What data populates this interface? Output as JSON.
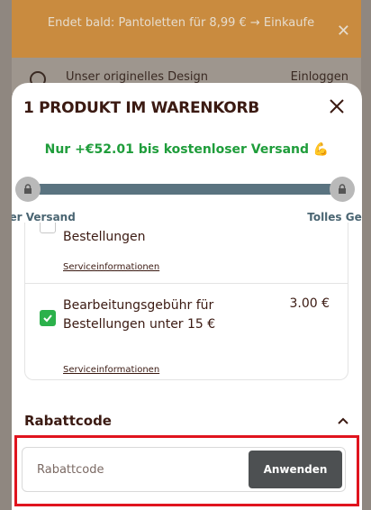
{
  "background": {
    "promo_text": "Endet bald: Pantoletten für 8,99 € → Einkaufe",
    "nav_brand": "Unser originelles Design",
    "nav_login": "Einloggen"
  },
  "cart": {
    "title": "1 PRODUKT IM WARENKORB",
    "shipping_message": "Nur +€52.01 bis kostenloser Versand 💪",
    "progress": {
      "fraction": 0,
      "left_label": "loser Versand",
      "right_label": "Tolles Gesc"
    },
    "items": [
      {
        "title": "Bestellungen",
        "link": "Serviceinformationen",
        "checked": false
      },
      {
        "title": "Bearbeitungsgebühr für Bestellungen unter 15 €",
        "price": "3.00 €",
        "link": "Serviceinformationen",
        "checked": true
      }
    ],
    "discount": {
      "heading": "Rabattcode",
      "placeholder": "Rabattcode",
      "apply_label": "Anwenden"
    }
  },
  "colors": {
    "accent_green": "#2bb14b",
    "progress_track": "#5a7380",
    "highlight_red": "#e0141e",
    "title_brown": "#3b1a12"
  }
}
